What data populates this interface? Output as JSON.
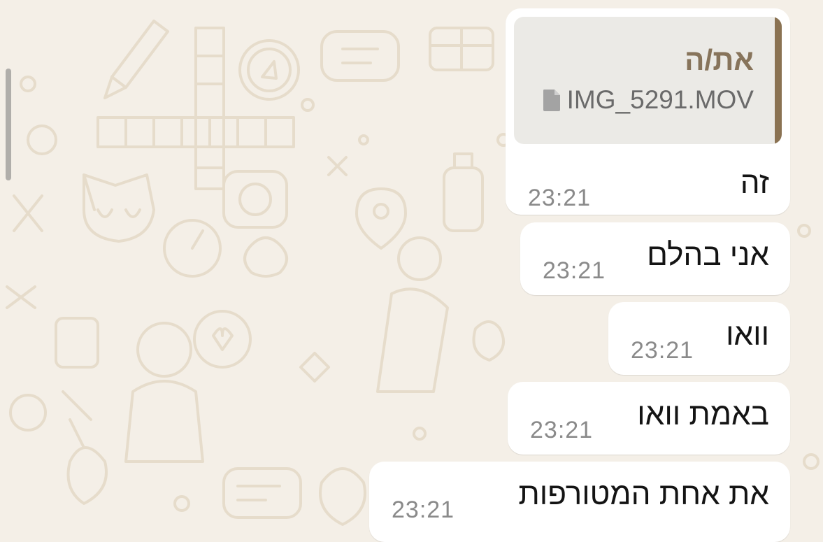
{
  "chat": {
    "messages": [
      {
        "reply_to": {
          "author": "את/ה",
          "file_name": "IMG_5291.MOV",
          "file_icon": "document-icon"
        },
        "text": "זה",
        "time": "23:21"
      },
      {
        "text": "אני בהלם",
        "time": "23:21"
      },
      {
        "text": "וואו",
        "time": "23:21"
      },
      {
        "text": "באמת וואו",
        "time": "23:21"
      },
      {
        "text": "את אחת המטורפות",
        "time": "23:21"
      }
    ]
  },
  "colors": {
    "wallpaper": "#f4efe7",
    "wallpaper_doodle": "#e6dccb",
    "bubble": "#ffffff",
    "quote_background": "#ebeae6",
    "quote_bar": "#8a7252",
    "quote_author": "#87745b",
    "timestamp": "#8a8a8a"
  }
}
